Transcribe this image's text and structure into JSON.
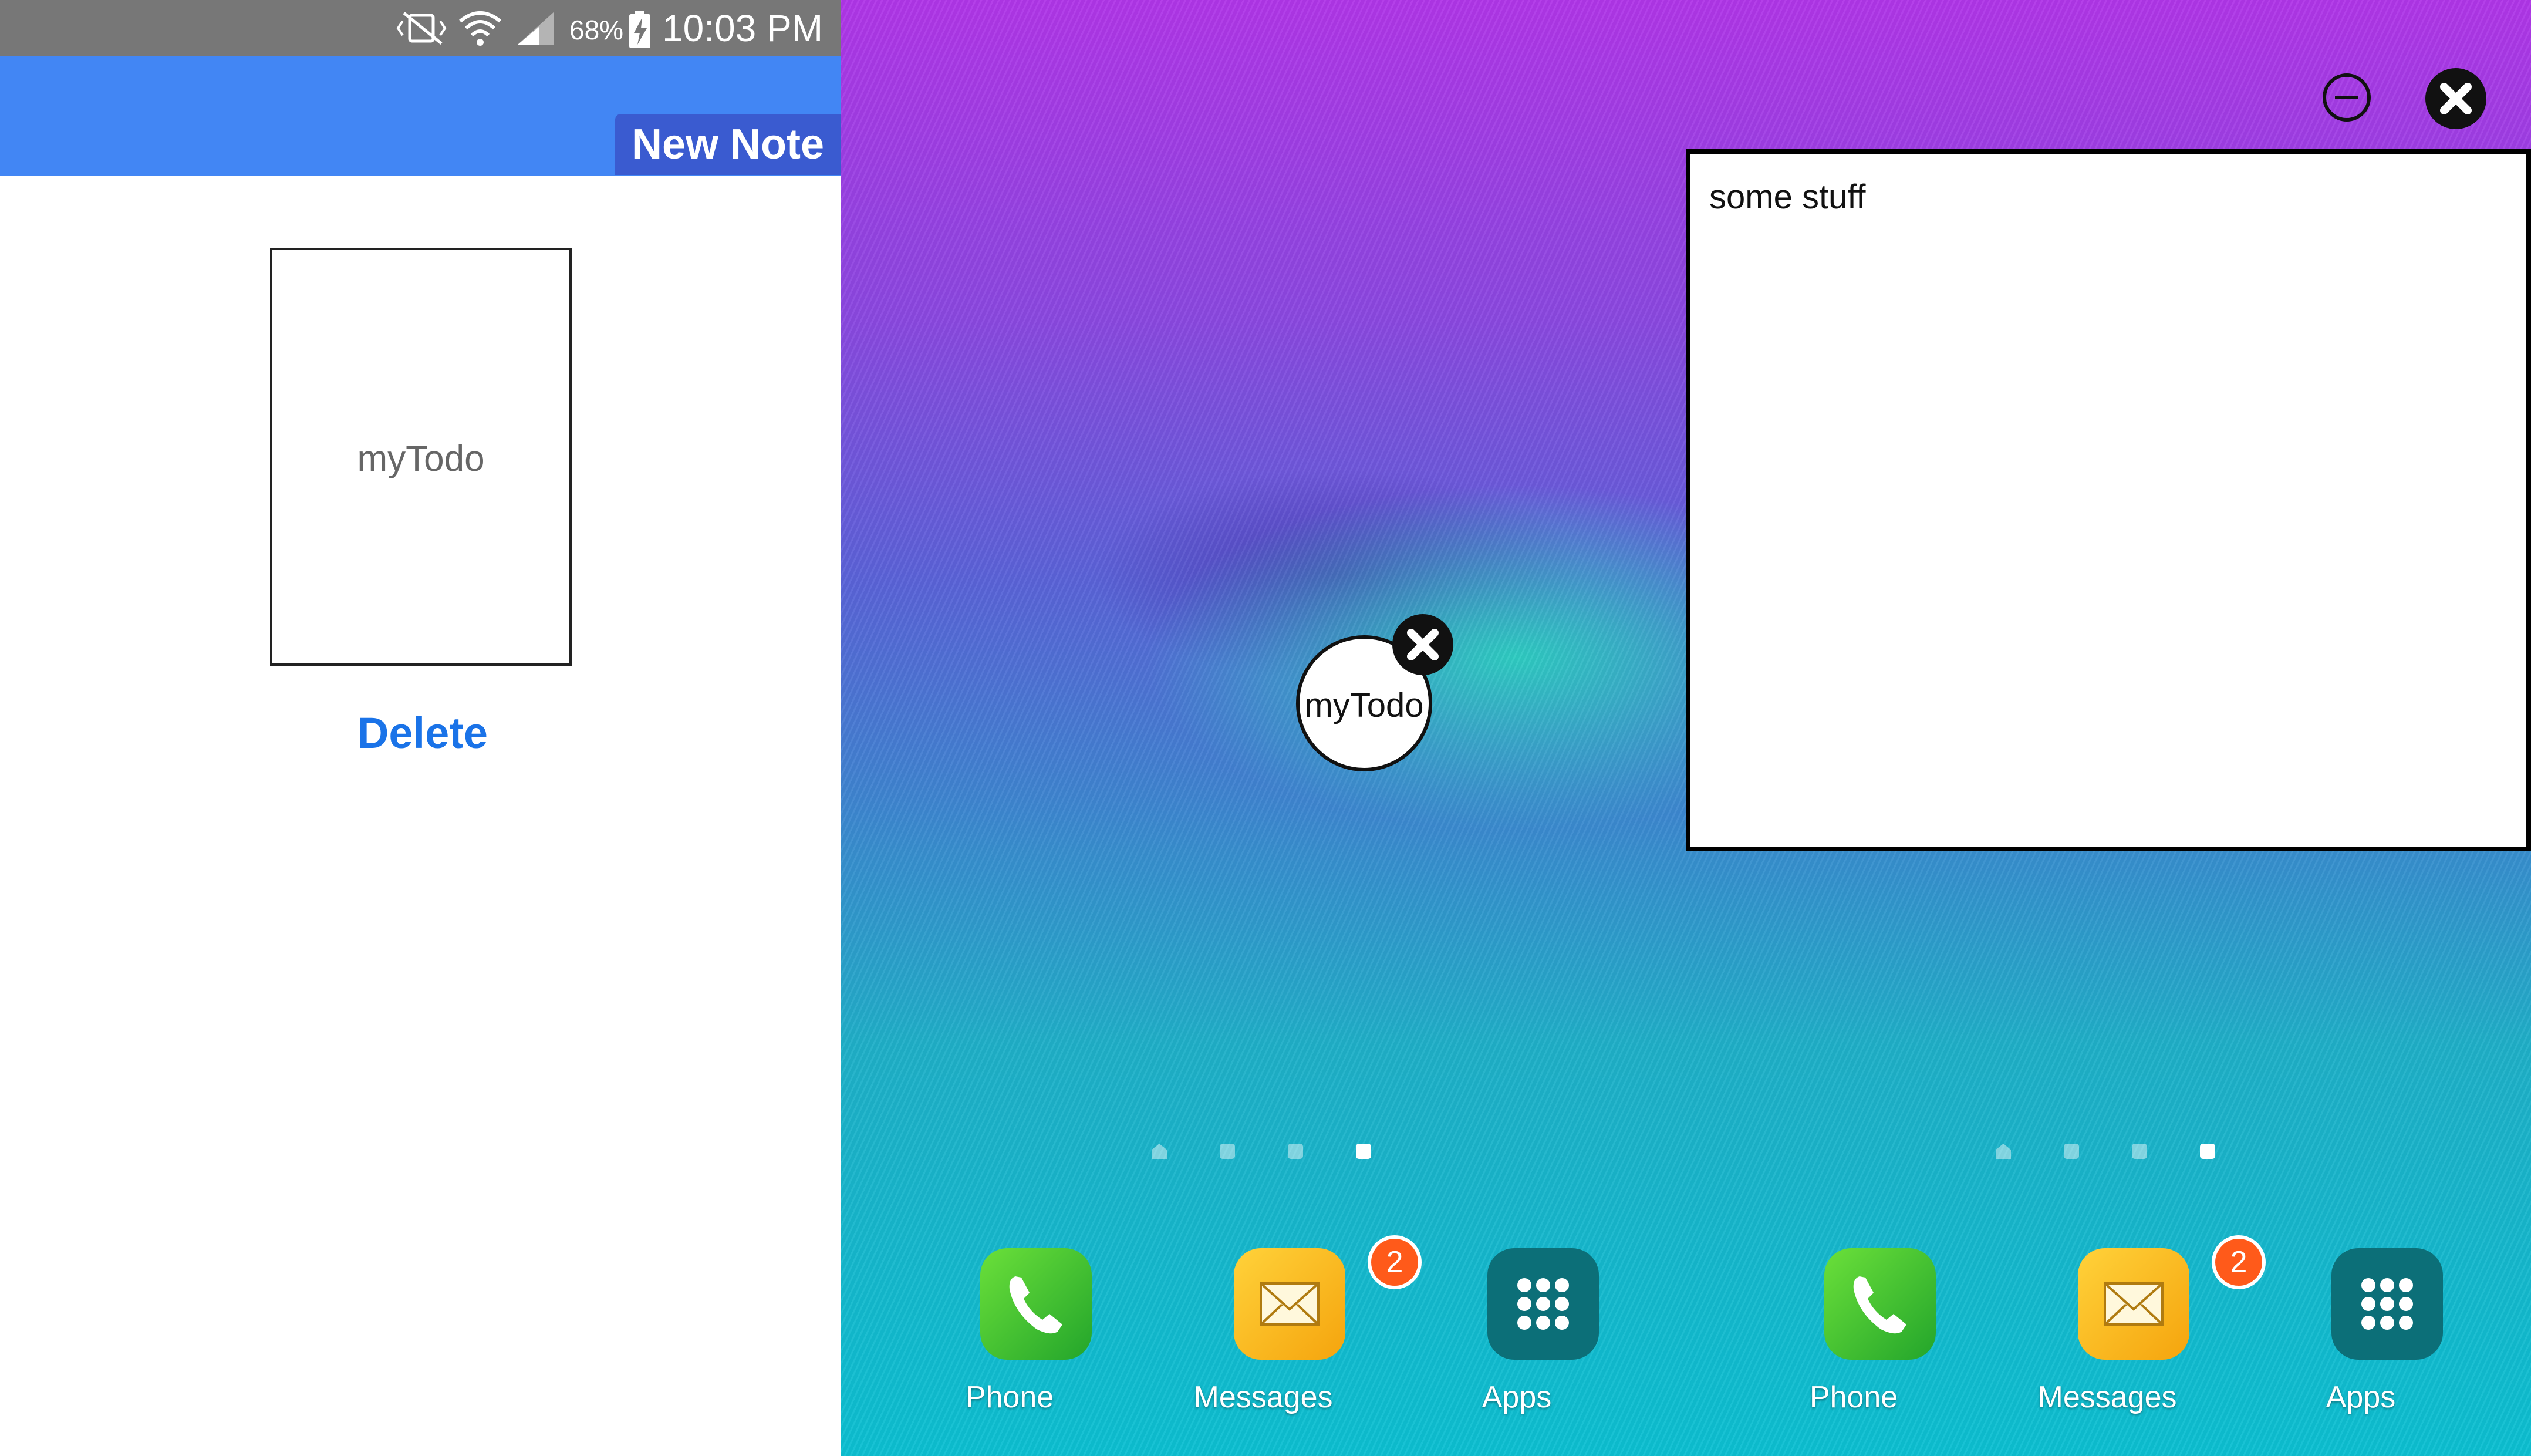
{
  "left_panel": {
    "statusbar": {
      "battery": "68%",
      "time": "10:03 PM"
    },
    "new_note_label": "New Note",
    "note": {
      "title": "myTodo"
    },
    "delete_label": "Delete",
    "colors": {
      "appbar": "#4286f4",
      "button": "#3a5bd0",
      "link": "#1a73e8"
    }
  },
  "middle_panel": {
    "bubble": {
      "label": "myTodo",
      "icon": "close-icon"
    },
    "page_indicator": {
      "count": 4,
      "active_index": 3
    },
    "dock": [
      {
        "label": "Phone",
        "icon": "phone-icon"
      },
      {
        "label": "Messages",
        "icon": "envelope-icon",
        "badge": "2"
      },
      {
        "label": "Apps",
        "icon": "apps-grid-icon"
      }
    ]
  },
  "right_panel": {
    "note_window": {
      "content": "some stuff"
    },
    "controls": [
      {
        "icon": "minimize-icon"
      },
      {
        "icon": "close-icon"
      }
    ],
    "page_indicator": {
      "count": 4,
      "active_index": 3
    },
    "dock": [
      {
        "label": "Phone",
        "icon": "phone-icon"
      },
      {
        "label": "Messages",
        "icon": "envelope-icon",
        "badge": "2"
      },
      {
        "label": "Apps",
        "icon": "apps-grid-icon"
      }
    ]
  }
}
